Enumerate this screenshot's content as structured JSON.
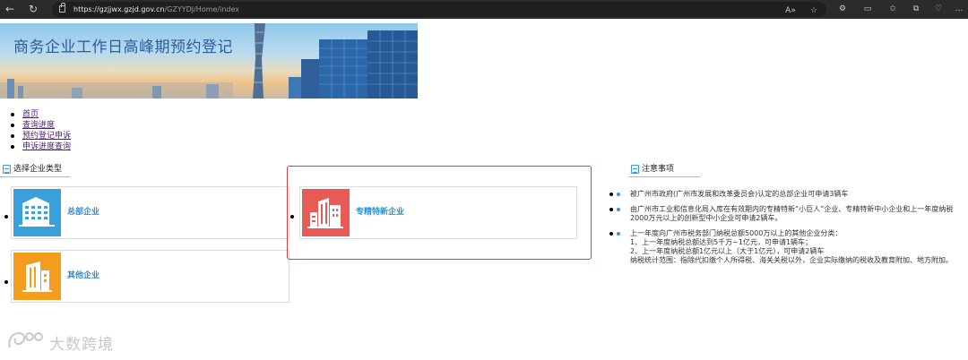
{
  "browser": {
    "url_host": "https://gzjjwx.gzjd.gov.cn",
    "url_path": "/GZYYDJ/Home/index"
  },
  "banner": {
    "title": "商务企业工作日高峰期预约登记"
  },
  "nav": {
    "items": [
      {
        "label": "首页"
      },
      {
        "label": "查询进度"
      },
      {
        "label": "预约登记申诉"
      },
      {
        "label": "申诉进度查询"
      }
    ]
  },
  "select_section": {
    "heading": "选择企业类型",
    "cards": [
      {
        "label": "总部企业",
        "icon": "office-building-icon",
        "color": "#3aa0dc"
      },
      {
        "label": "专精特新企业",
        "icon": "city-buildings-icon",
        "color": "#e85a55"
      },
      {
        "label": "其他企业",
        "icon": "tower-building-icon",
        "color": "#f39c1e"
      }
    ]
  },
  "notes_section": {
    "heading": "注意事项",
    "items": [
      "被广州市政府(广州市发展和改革委员会)认定的总部企业可申请3辆车",
      "由广州市工业和信息化局入库在有效期内的专精特新“小巨人”企业、专精特新中小企业和上一年度纳税2000万元以上的创新型中小企业可申请2辆车。",
      "上一年度向广州市税务部门纳税总额5000万以上的其他企业分类：\n1、上一年度纳税总额达到5千万~1亿元，可申请1辆车；\n2、上一年度纳税总额1亿元以上（大于1亿元），可申请2辆车\n纳税统计范围：指除代扣缴个人所得税、海关关税以外，企业实际缴纳的税收及教育附加、地方附加。"
    ]
  },
  "watermark": {
    "text": "大数跨境"
  },
  "colors": {
    "link_blue": "#2a8fd6",
    "highlight_red": "#e53935",
    "visited_link": "#551a8b"
  }
}
